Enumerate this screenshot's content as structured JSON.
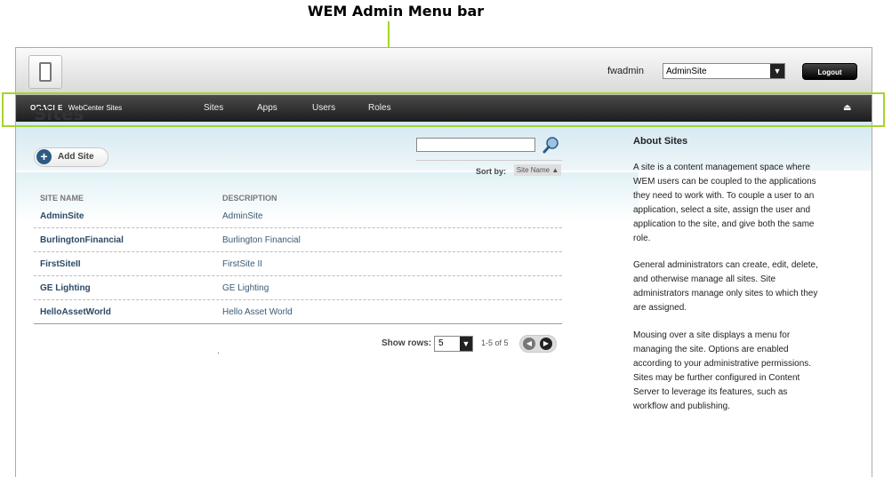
{
  "annotation": {
    "title": "WEM Admin Menu bar"
  },
  "header": {
    "user": "fwadmin",
    "site_selector": {
      "value": "AdminSite"
    },
    "logout_label": "Logout"
  },
  "menubar": {
    "brand_oracle": "ORACLE",
    "brand_product": "WebCenter Sites",
    "items": [
      {
        "label": "Sites"
      },
      {
        "label": "Apps"
      },
      {
        "label": "Users"
      },
      {
        "label": "Roles"
      }
    ]
  },
  "page": {
    "title": "Sites",
    "add_button_label": "Add Site",
    "search": {
      "placeholder": ""
    },
    "sort_by_label": "Sort by:",
    "sort_value": "Site Name ▲",
    "table": {
      "headers": {
        "name": "SITE NAME",
        "description": "DESCRIPTION"
      },
      "rows": [
        {
          "name": "AdminSite",
          "description": "AdminSite"
        },
        {
          "name": "BurlingtonFinancial",
          "description": "Burlington Financial"
        },
        {
          "name": "FirstSiteII",
          "description": "FirstSite II"
        },
        {
          "name": "GE Lighting",
          "description": "GE Lighting"
        },
        {
          "name": "HelloAssetWorld",
          "description": "Hello Asset World"
        }
      ]
    },
    "pagination": {
      "show_rows_label": "Show rows:",
      "rows_value": "5",
      "count_text": "1-5 of 5"
    }
  },
  "sidebar": {
    "title": "About Sites",
    "paragraphs": [
      "A site is a content management space where WEM users can be coupled to the applications they need to work with. To couple a user to an application, select a site, assign the user and application to the site, and give both the same role.",
      "General administrators can create, edit, delete, and otherwise manage all sites. Site administrators manage only sites to which they are assigned.",
      "Mousing over a site displays a menu for managing the site. Options are enabled according to your administrative permissions. Sites may be further configured in Content Server to leverage its features, such as workflow and publishing."
    ]
  },
  "colors": {
    "highlight": "#a6d52a",
    "menubar": "#2a2a2a",
    "link": "#2b4a66",
    "band": "#d4e8f1"
  }
}
